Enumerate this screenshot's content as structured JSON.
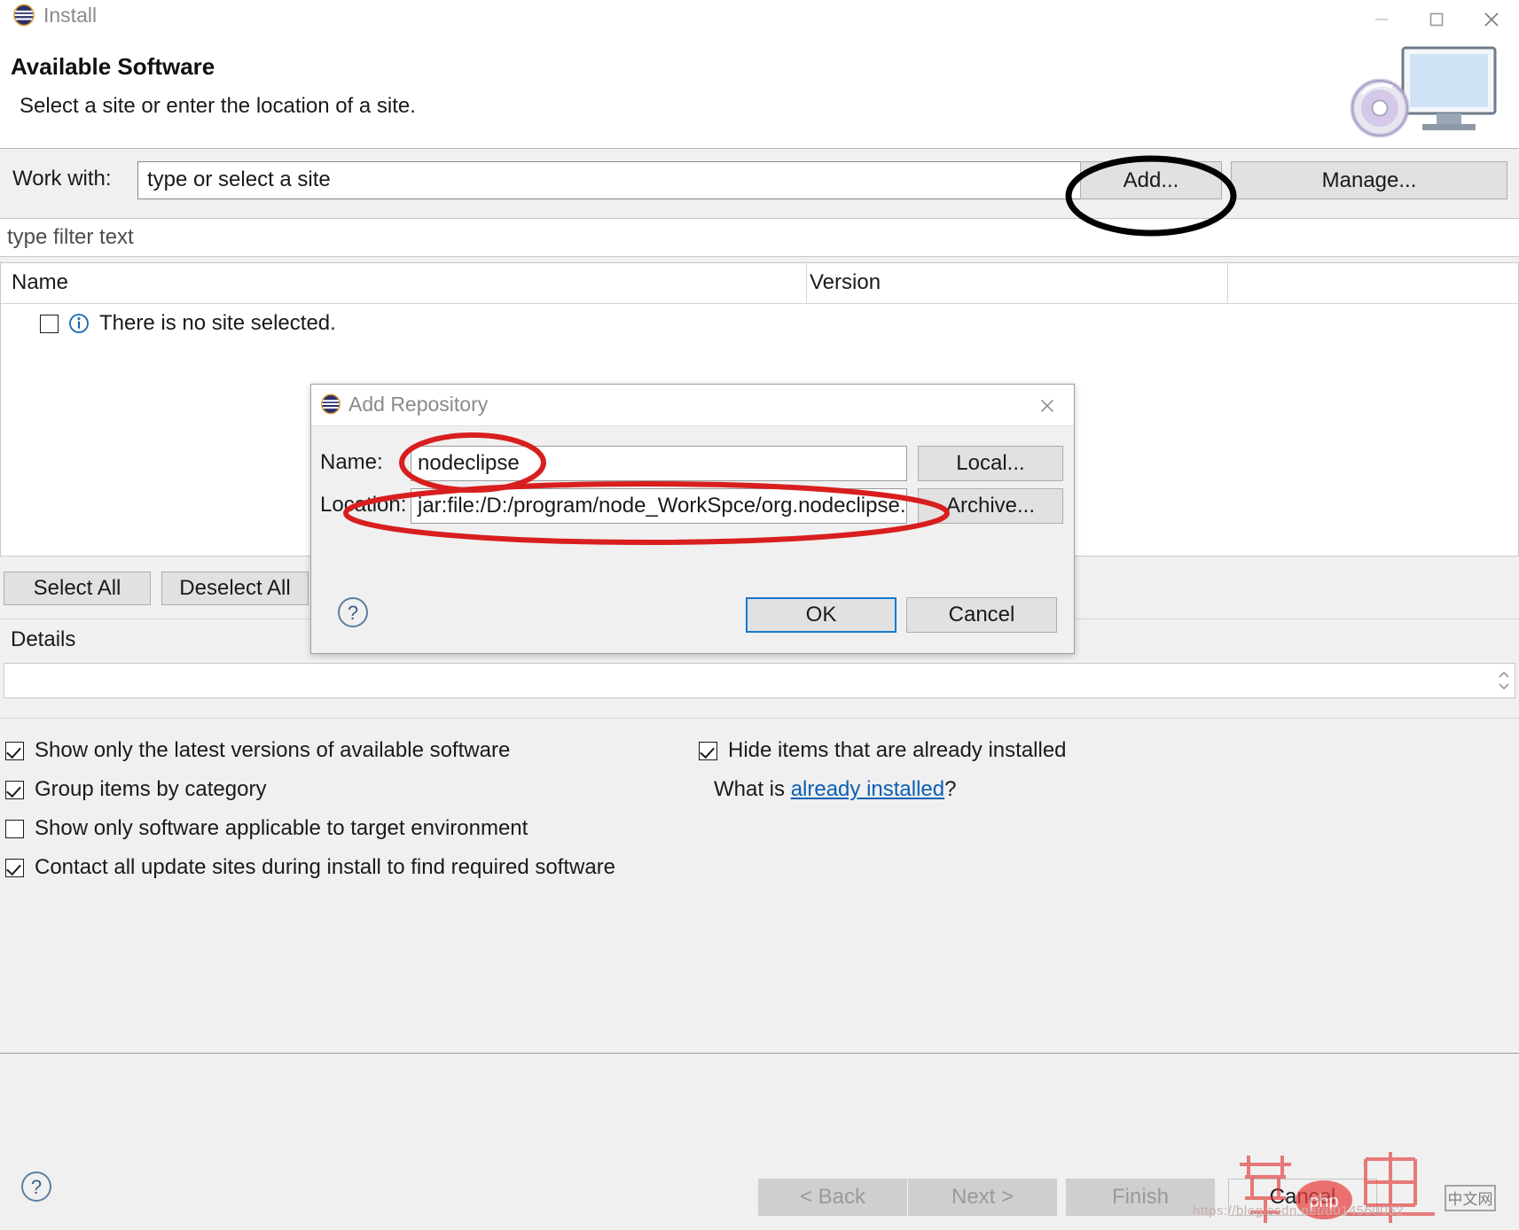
{
  "window": {
    "title": "Install",
    "icon": "eclipse-icon",
    "controls": {
      "minimize": "minimize-icon",
      "maximize": "maximize-icon",
      "close": "close-icon"
    }
  },
  "header": {
    "title": "Available Software",
    "subtitle": "Select a site or enter the location of a site.",
    "art": "install-cd-monitor-icon"
  },
  "work_with": {
    "label": "Work with:",
    "value": "type or select a site",
    "placeholder": "type or select a site",
    "add_label": "Add...",
    "manage_label": "Manage..."
  },
  "filter": {
    "value": "type filter text",
    "placeholder": "type filter text"
  },
  "table": {
    "columns": [
      "Name",
      "Version"
    ],
    "rows": [
      {
        "checked": false,
        "icon": "info-icon",
        "name": "There is no site selected.",
        "version": ""
      }
    ]
  },
  "list_actions": {
    "select_all": "Select All",
    "deselect_all": "Deselect All"
  },
  "details": {
    "label": "Details",
    "value": ""
  },
  "options": [
    {
      "label": "Show only the latest versions of available software",
      "checked": true
    },
    {
      "label": "Group items by category",
      "checked": true
    },
    {
      "label": "Show only software applicable to target environment",
      "checked": false
    },
    {
      "label": "Contact all update sites during install to find required software",
      "checked": true
    }
  ],
  "options_right": {
    "hide_installed": {
      "label": "Hide items that are already installed",
      "checked": true
    },
    "what_is_prefix": "What is ",
    "what_is_link": "already installed",
    "what_is_suffix": "?"
  },
  "wizard_buttons": {
    "help": "help-icon",
    "back": "< Back",
    "next": "Next >",
    "finish": "Finish",
    "cancel": "Cancel"
  },
  "dialog": {
    "title": "Add Repository",
    "icon": "eclipse-icon",
    "close": "close-icon",
    "name_label": "Name:",
    "name_value": "nodeclipse",
    "location_label": "Location:",
    "location_value": "jar:file:/D:/program/node_WorkSpce/org.nodeclipse.s",
    "local_label": "Local...",
    "archive_label": "Archive...",
    "help": "help-icon",
    "ok_label": "OK",
    "cancel_label": "Cancel"
  },
  "annotations": [
    {
      "name": "add-button-highlight",
      "shape": "ellipse",
      "color": "#000000"
    },
    {
      "name": "name-field-highlight",
      "shape": "ellipse",
      "color": "#d81e1e"
    },
    {
      "name": "location-field-highlight",
      "shape": "ellipse",
      "color": "#d81e1e"
    }
  ],
  "watermark": {
    "url": "https://blog.csdn.net/u014560062",
    "text": "php中文网"
  },
  "colors": {
    "accent": "#1578cf",
    "link": "#0b5fb5",
    "dialog_bg": "#f0f0f0",
    "window_bg": "#f0f0f0",
    "annotation_black": "#000000",
    "annotation_red": "#d81e1e"
  }
}
